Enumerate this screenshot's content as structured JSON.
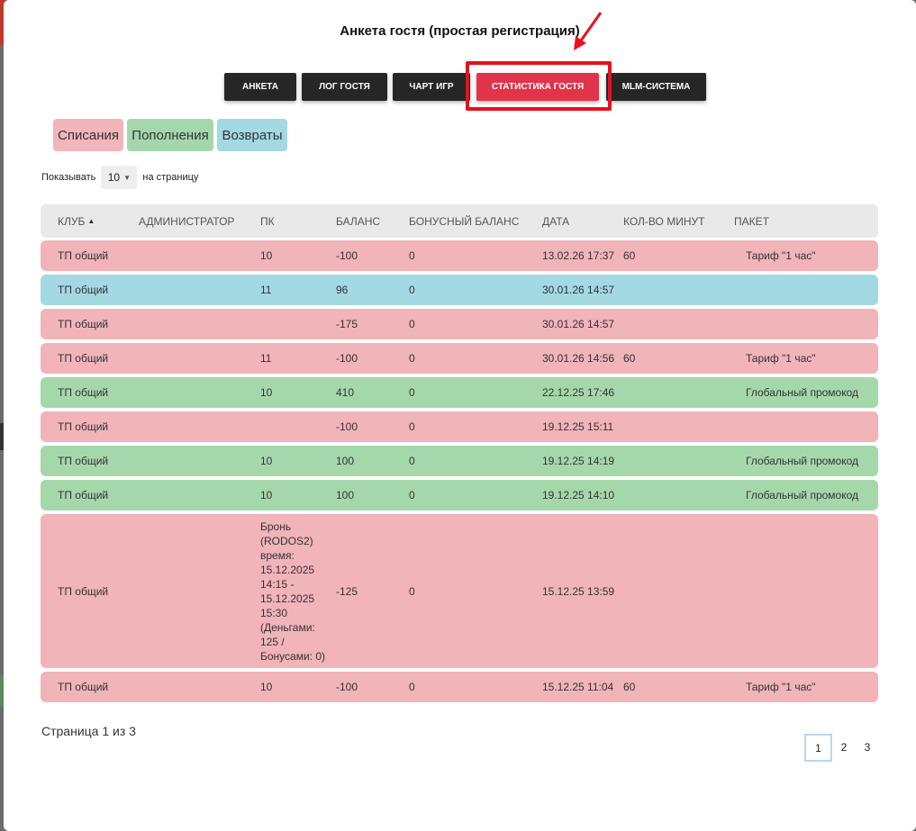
{
  "modal": {
    "title": "Анкета гостя (простая регистрация)"
  },
  "tabs": [
    {
      "label": "Анкета"
    },
    {
      "label": "Лог гостя"
    },
    {
      "label": "Чарт игр"
    },
    {
      "label": "Статистика гостя",
      "active": true
    },
    {
      "label": "MLM-Система"
    }
  ],
  "filters": {
    "writeoffs": "Списания",
    "topups": "Пополнения",
    "returns": "Возвраты"
  },
  "perpage": {
    "prefix": "Показывать",
    "value": "10",
    "suffix": "на страницу"
  },
  "table": {
    "columns": [
      "Клуб",
      "Администратор",
      "ПК",
      "Баланс",
      "Бонусный баланс",
      "Дата",
      "Кол-во минут",
      "Пакет"
    ],
    "rows": [
      {
        "club": "ТП общий",
        "admin": "",
        "pc": "10",
        "balance": "-100",
        "bonus": "0",
        "date": "13.02.26 17:37",
        "minutes": "60",
        "package": "Тариф \"1 час\"",
        "type": "red"
      },
      {
        "club": "ТП общий",
        "admin": "",
        "pc": "11",
        "balance": "96",
        "bonus": "0",
        "date": "30.01.26 14:57",
        "minutes": "",
        "package": "",
        "type": "blue"
      },
      {
        "club": "ТП общий",
        "admin": "",
        "pc": "",
        "balance": "-175",
        "bonus": "0",
        "date": "30.01.26 14:57",
        "minutes": "",
        "package": "",
        "type": "red"
      },
      {
        "club": "ТП общий",
        "admin": "",
        "pc": "11",
        "balance": "-100",
        "bonus": "0",
        "date": "30.01.26 14:56",
        "minutes": "60",
        "package": "Тариф \"1 час\"",
        "type": "red"
      },
      {
        "club": "ТП общий",
        "admin": "",
        "pc": "10",
        "balance": "410",
        "bonus": "0",
        "date": "22.12.25 17:46",
        "minutes": "",
        "package": "Глобальный промокод",
        "type": "green"
      },
      {
        "club": "ТП общий",
        "admin": "",
        "pc": "",
        "balance": "-100",
        "bonus": "0",
        "date": "19.12.25 15:11",
        "minutes": "",
        "package": "",
        "type": "red"
      },
      {
        "club": "ТП общий",
        "admin": "",
        "pc": "10",
        "balance": "100",
        "bonus": "0",
        "date": "19.12.25 14:19",
        "minutes": "",
        "package": "Глобальный промокод",
        "type": "green"
      },
      {
        "club": "ТП общий",
        "admin": "",
        "pc": "10",
        "balance": "100",
        "bonus": "0",
        "date": "19.12.25 14:10",
        "minutes": "",
        "package": "Глобальный промокод",
        "type": "green"
      },
      {
        "club": "ТП общий",
        "admin": "",
        "pc": "Бронь\n(RODOS2)\nвремя:\n15.12.2025\n14:15 -\n15.12.2025\n15:30\n(Деньгами:\n125 /\nБонусами: 0)",
        "balance": "-125",
        "bonus": "0",
        "date": "15.12.25 13:59",
        "minutes": "",
        "package": "",
        "type": "red"
      },
      {
        "club": "ТП общий",
        "admin": "",
        "pc": "10",
        "balance": "-100",
        "bonus": "0",
        "date": "15.12.25 11:04",
        "minutes": "60",
        "package": "Тариф \"1 час\"",
        "type": "red"
      }
    ]
  },
  "pagination": {
    "info": "Страница 1 из 3",
    "pages": [
      "1",
      "2",
      "3"
    ],
    "current": "1"
  },
  "colors": {
    "accent": "#e0344a",
    "highlight": "#e8101c",
    "writeoff": "#f1b4b8",
    "topup": "#a4d8ab",
    "return": "#a3d9e3"
  }
}
